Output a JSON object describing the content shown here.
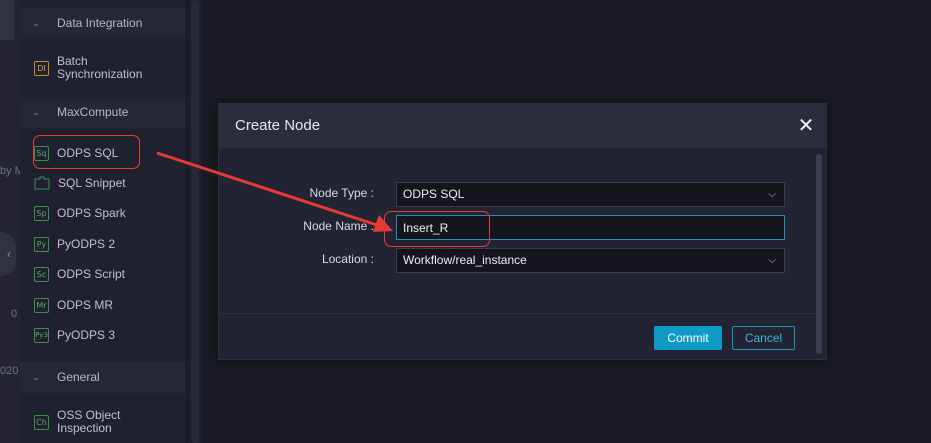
{
  "left_edge": {
    "texts": [
      "by M",
      "0",
      "020"
    ]
  },
  "sidebar": {
    "sections": [
      {
        "title": "Data Integration",
        "items": [
          {
            "icon": "di-icon",
            "icon_text": "DI",
            "label": "Batch Synchronization"
          }
        ]
      },
      {
        "title": "MaxCompute",
        "items": [
          {
            "icon_text": "Sq",
            "label": "ODPS SQL"
          },
          {
            "icon_text": "",
            "label": "SQL Snippet"
          },
          {
            "icon_text": "Sp",
            "label": "ODPS Spark"
          },
          {
            "icon_text": "Py",
            "label": "PyODPS 2"
          },
          {
            "icon_text": "Sc",
            "label": "ODPS Script"
          },
          {
            "icon_text": "Mr",
            "label": "ODPS MR"
          },
          {
            "icon_text": "Py3",
            "label": "PyODPS 3"
          }
        ]
      },
      {
        "title": "General",
        "items": [
          {
            "icon_text": "Ch",
            "label": "OSS Object Inspection"
          }
        ]
      }
    ]
  },
  "modal": {
    "title": "Create Node",
    "close": "✕",
    "fields": {
      "node_type": {
        "label": "Node Type :",
        "value": "ODPS SQL"
      },
      "node_name": {
        "label": "Node Name :",
        "value": "Insert_R"
      },
      "location": {
        "label": "Location :",
        "value": "Workflow/real_instance"
      }
    },
    "buttons": {
      "commit": "Commit",
      "cancel": "Cancel"
    }
  },
  "colors": {
    "accent": "#0e9ac4",
    "annotation": "#e53a35",
    "background": "#191a23"
  }
}
